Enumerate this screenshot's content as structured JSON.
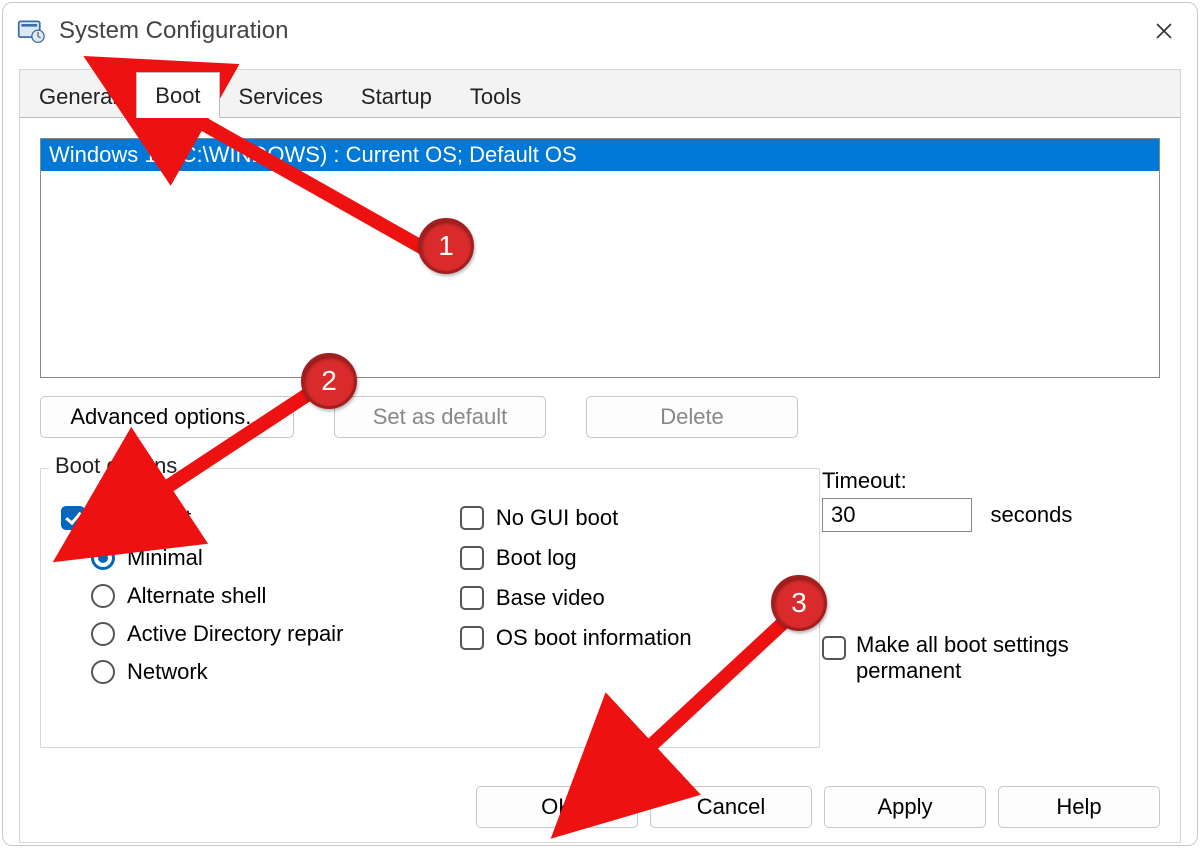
{
  "window": {
    "title": "System Configuration"
  },
  "tabs": {
    "general": "General",
    "boot": "Boot",
    "services": "Services",
    "startup": "Startup",
    "tools": "Tools",
    "active": "boot"
  },
  "os_list": {
    "item0": "Windows 11 (C:\\WINDOWS) : Current OS; Default OS"
  },
  "buttons": {
    "advanced": "Advanced options...",
    "set_default": "Set as default",
    "delete": "Delete"
  },
  "boot_options": {
    "legend": "Boot options",
    "safe_boot": "Safe boot",
    "radios": {
      "minimal": "Minimal",
      "alt_shell": "Alternate shell",
      "ad_repair": "Active Directory repair",
      "network": "Network"
    },
    "checks": {
      "no_gui": "No GUI boot",
      "boot_log": "Boot log",
      "base_video": "Base video",
      "os_info": "OS boot information"
    }
  },
  "timeout": {
    "label": "Timeout:",
    "value": "30",
    "unit": "seconds"
  },
  "permanent": "Make all boot settings permanent",
  "dialog": {
    "ok": "OK",
    "cancel": "Cancel",
    "apply": "Apply",
    "help": "Help"
  },
  "annotations": {
    "n1": "1",
    "n2": "2",
    "n3": "3"
  }
}
